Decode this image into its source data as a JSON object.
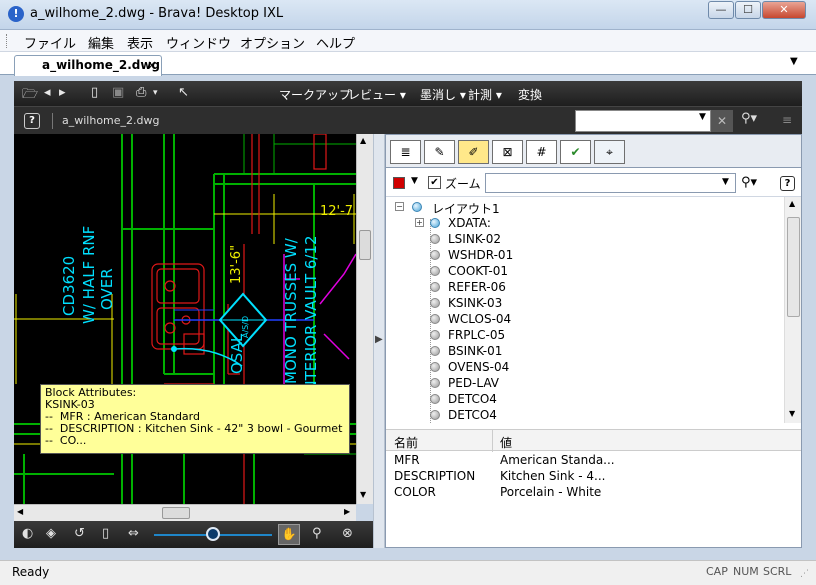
{
  "window": {
    "title": "a_wilhome_2.dwg - Brava! Desktop IXL",
    "minimize": "—",
    "maximize": "☐",
    "close": "✕"
  },
  "menubar": [
    "ファイル",
    "編集",
    "表示",
    "ウィンドウ",
    "オプション",
    "ヘルプ"
  ],
  "tab": {
    "label": "a_wilhome_2.dwg",
    "close": "×"
  },
  "toolbar": {
    "menus": [
      "マークアップ",
      "レビュー ▾",
      "墨消し ▾",
      "計測 ▾",
      "変換"
    ]
  },
  "breadcrumb": {
    "help": "?",
    "file": "a_wilhome_2.dwg"
  },
  "search": {
    "value": "",
    "clear": "✕"
  },
  "drawing": {
    "dim": "12'-7",
    "vertical_texts": [
      "CD3620",
      "W/ HALF RNF",
      "OVER",
      "13'-6\"",
      "MONO TRUSSES W/",
      "INTERIOR VAULT 6/12",
      "OSAL"
    ],
    "bubble_label": "A/S/D"
  },
  "tooltip": {
    "lines": [
      "Block Attributes:",
      "KSINK-03",
      "--  MFR : American Standard",
      "--  DESCRIPTION : Kitchen Sink - 42\" 3 bowl - Gourmet",
      "--  CO..."
    ]
  },
  "panel": {
    "zoom_label": "ズーム",
    "layer_select_value": "",
    "help": "?",
    "tree": {
      "root": "レイアウト1",
      "xdata": "XDATA:",
      "items": [
        "LSINK-02",
        "WSHDR-01",
        "COOKT-01",
        "REFER-06",
        "KSINK-03",
        "WCLOS-04",
        "FRPLC-05",
        "BSINK-01",
        "OVENS-04",
        "PED-LAV",
        "DETCO4",
        "DETCO4"
      ]
    },
    "props": {
      "header_name": "名前",
      "header_value": "値",
      "rows": [
        {
          "name": "MFR",
          "value": "American Standa..."
        },
        {
          "name": "DESCRIPTION",
          "value": "Kitchen Sink - 4..."
        },
        {
          "name": "COLOR",
          "value": "Porcelain - White"
        }
      ]
    }
  },
  "status": {
    "text": "Ready",
    "indicators": [
      "CAP",
      "NUM",
      "SCRL"
    ]
  },
  "colors": {
    "accent": "#1f86c9",
    "cad_green": "#00b000",
    "cad_red": "#e01818",
    "cad_yellow": "#f0f000",
    "cad_cyan": "#00e0ff",
    "cad_magenta": "#e000e0"
  }
}
